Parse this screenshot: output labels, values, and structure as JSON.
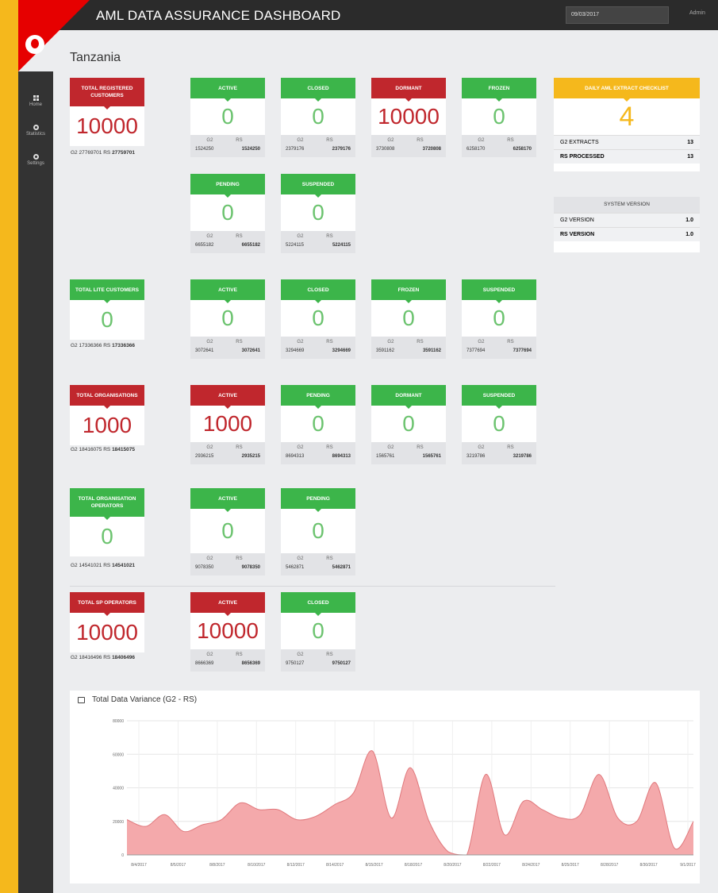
{
  "app": {
    "title": "AML DATA ASSURANCE DASHBOARD",
    "date_value": "09/03/2017",
    "user": "Admin"
  },
  "sidebar": {
    "items": [
      {
        "label": "Home"
      },
      {
        "label": "Statistics"
      },
      {
        "label": "Settings"
      }
    ]
  },
  "page": {
    "country": "Tanzania"
  },
  "registered": {
    "total": {
      "label": "TOTAL REGISTERED CUSTOMERS",
      "value": "10000",
      "g2": "27769701",
      "rs": "27759701"
    },
    "cards": [
      {
        "label": "ACTIVE",
        "value": "0",
        "g2": "1524250",
        "rs": "1524250"
      },
      {
        "label": "CLOSED",
        "value": "0",
        "g2": "2379176",
        "rs": "2379176"
      },
      {
        "label": "DORMANT",
        "value": "10000",
        "g2": "3730808",
        "rs": "3720808"
      },
      {
        "label": "FROZEN",
        "value": "0",
        "g2": "6258170",
        "rs": "6258170"
      },
      {
        "label": "PENDING",
        "value": "0",
        "g2": "6655182",
        "rs": "6655182"
      },
      {
        "label": "SUSPENDED",
        "value": "0",
        "g2": "5224115",
        "rs": "5224115"
      }
    ]
  },
  "lite": {
    "total": {
      "label": "TOTAL LITE CUSTOMERS",
      "value": "0",
      "g2": "17336366",
      "rs": "17336366"
    },
    "cards": [
      {
        "label": "ACTIVE",
        "value": "0",
        "g2": "3072641",
        "rs": "3072641"
      },
      {
        "label": "CLOSED",
        "value": "0",
        "g2": "3294669",
        "rs": "3294669"
      },
      {
        "label": "FROZEN",
        "value": "0",
        "g2": "3591162",
        "rs": "3591162"
      },
      {
        "label": "SUSPENDED",
        "value": "0",
        "g2": "7377694",
        "rs": "7377694"
      }
    ]
  },
  "orgs": {
    "total": {
      "label": "TOTAL ORGANISATIONS",
      "value": "1000",
      "g2": "18416075",
      "rs": "18415075"
    },
    "cards": [
      {
        "label": "ACTIVE",
        "value": "1000",
        "g2": "2936215",
        "rs": "2935215"
      },
      {
        "label": "PENDING",
        "value": "0",
        "g2": "8694313",
        "rs": "8694313"
      },
      {
        "label": "DORMANT",
        "value": "0",
        "g2": "1565761",
        "rs": "1565761"
      },
      {
        "label": "SUSPENDED",
        "value": "0",
        "g2": "3219786",
        "rs": "3219786"
      }
    ]
  },
  "org_ops": {
    "total": {
      "label": "TOTAL ORGANISATION OPERATORS",
      "value": "0",
      "g2": "14541021",
      "rs": "14541021"
    },
    "cards": [
      {
        "label": "ACTIVE",
        "value": "0",
        "g2": "9078350",
        "rs": "9078350"
      },
      {
        "label": "PENDING",
        "value": "0",
        "g2": "5462871",
        "rs": "5462871"
      }
    ]
  },
  "sp_ops": {
    "total": {
      "label": "TOTAL SP OPERATORS",
      "value": "10000",
      "g2": "18416496",
      "rs": "18406496"
    },
    "cards": [
      {
        "label": "ACTIVE",
        "value": "10000",
        "g2": "8666369",
        "rs": "8656369"
      },
      {
        "label": "CLOSED",
        "value": "0",
        "g2": "9750127",
        "rs": "9750127"
      }
    ]
  },
  "labels": {
    "g2": "G2",
    "rs": "RS"
  },
  "checklist": {
    "title": "DAILY AML EXTRACT CHECKLIST",
    "value": "4",
    "rows": [
      {
        "label": "G2 EXTRACTS",
        "value": "13"
      },
      {
        "label": "RS PROCESSED",
        "value": "13"
      }
    ]
  },
  "version": {
    "title": "SYSTEM VERSION",
    "rows": [
      {
        "label": "G2 VERSION",
        "value": "1.0"
      },
      {
        "label": "RS VERSION",
        "value": "1.0"
      }
    ]
  },
  "colors": {
    "red": "#c0272d",
    "green": "#3cb54a",
    "yellow": "#f5b81c",
    "chart_fill": "#f4a9ab",
    "chart_line": "#e0787c"
  },
  "chart_data": {
    "type": "area",
    "title": "Total Data Variance (G2 - RS)",
    "ylim": [
      0,
      80000
    ],
    "y_ticks": [
      "80000",
      "60000",
      "40000",
      "20000",
      "0"
    ],
    "x_ticks": [
      "8/4/2017",
      "8/5/2017",
      "8/8/2017",
      "8/10/2017",
      "8/12/2017",
      "8/14/2017",
      "8/15/2017",
      "8/18/2017",
      "8/20/2017",
      "8/22/2017",
      "8/24/2017",
      "8/25/2017",
      "8/28/2017",
      "8/30/2017",
      "9/1/2017"
    ],
    "grid": true,
    "series": [
      {
        "values": [
          21000,
          17000,
          24000,
          14000,
          18000,
          21000,
          31000,
          27000,
          27000,
          21000,
          23000,
          30000,
          37000,
          62000,
          22000,
          52000,
          20000,
          2000,
          0,
          48000,
          12000,
          32000,
          27000,
          22000,
          24000,
          48000,
          22000,
          20000,
          43000,
          4000,
          20000
        ]
      }
    ]
  }
}
